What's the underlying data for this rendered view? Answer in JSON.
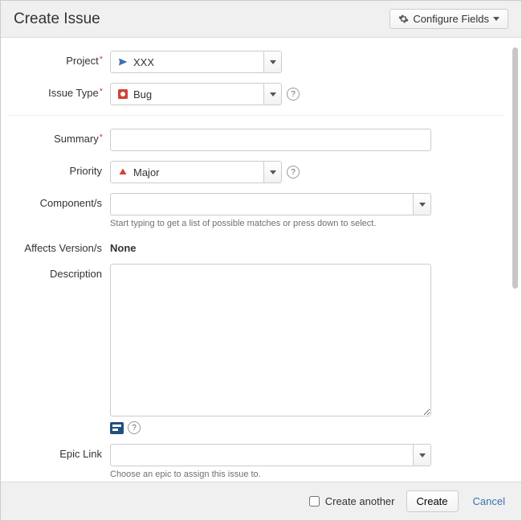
{
  "header": {
    "title": "Create Issue",
    "configure_label": "Configure Fields"
  },
  "fields": {
    "project": {
      "label": "Project",
      "value": "XXX"
    },
    "issueType": {
      "label": "Issue Type",
      "value": "Bug"
    },
    "summary": {
      "label": "Summary",
      "value": ""
    },
    "priority": {
      "label": "Priority",
      "value": "Major"
    },
    "components": {
      "label": "Component/s",
      "value": "",
      "hint": "Start typing to get a list of possible matches or press down to select."
    },
    "affectsVersions": {
      "label": "Affects Version/s",
      "value": "None"
    },
    "description": {
      "label": "Description",
      "value": ""
    },
    "epicLink": {
      "label": "Epic Link",
      "value": "",
      "hint": "Choose an epic to assign this issue to."
    }
  },
  "footer": {
    "createAnother": "Create another",
    "create": "Create",
    "cancel": "Cancel"
  }
}
